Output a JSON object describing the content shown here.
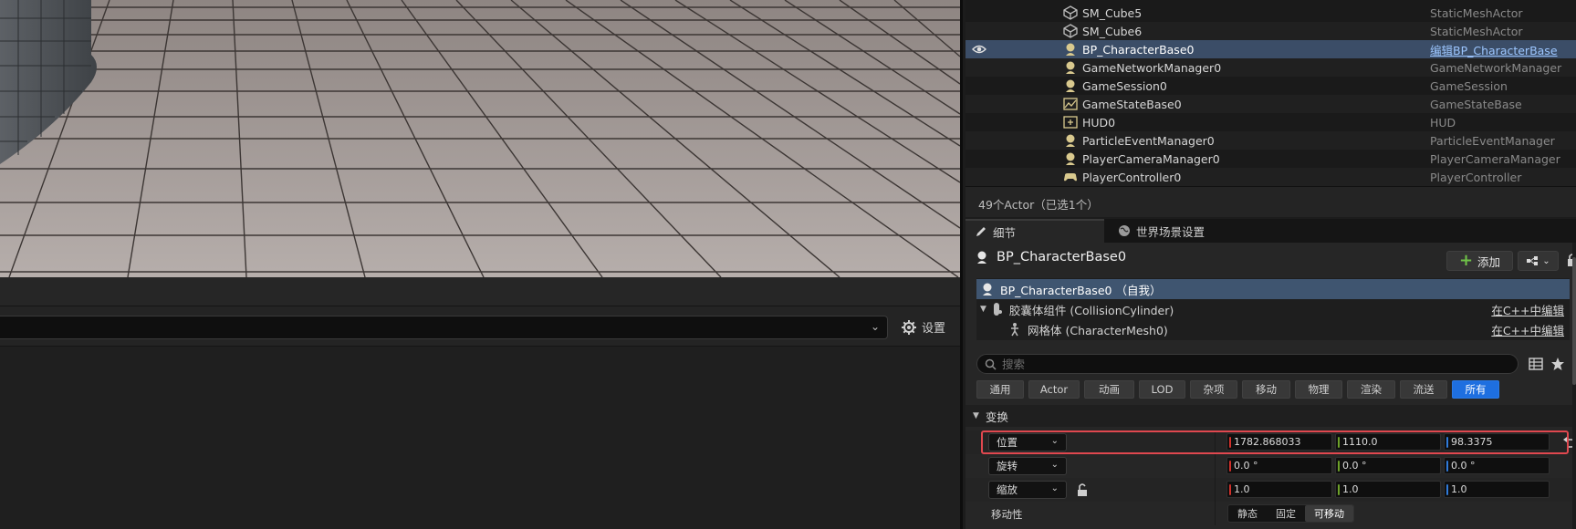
{
  "viewport": {
    "name": "level-viewport"
  },
  "bottom_left": {
    "settings_label": "设置"
  },
  "outliner": {
    "rows": [
      {
        "name": "SM_Cube5",
        "type": "StaticMeshActor",
        "icon": "static-mesh-icon"
      },
      {
        "name": "SM_Cube6",
        "type": "StaticMeshActor",
        "icon": "static-mesh-icon"
      },
      {
        "name": "BP_CharacterBase0",
        "type": "编辑BP_CharacterBase",
        "icon": "pawn-icon",
        "selected": true
      },
      {
        "name": "GameNetworkManager0",
        "type": "GameNetworkManager",
        "icon": "actor-icon"
      },
      {
        "name": "GameSession0",
        "type": "GameSession",
        "icon": "actor-icon"
      },
      {
        "name": "GameStateBase0",
        "type": "GameStateBase",
        "icon": "game-state-icon"
      },
      {
        "name": "HUD0",
        "type": "HUD",
        "icon": "hud-icon"
      },
      {
        "name": "ParticleEventManager0",
        "type": "ParticleEventManager",
        "icon": "actor-icon"
      },
      {
        "name": "PlayerCameraManager0",
        "type": "PlayerCameraManager",
        "icon": "actor-icon"
      },
      {
        "name": "PlayerController0",
        "type": "PlayerController",
        "icon": "gamepad-icon"
      }
    ],
    "status": "49个Actor（已选1个）"
  },
  "tabs": {
    "details": "细节",
    "world_settings": "世界场景设置"
  },
  "details": {
    "actor_name": "BP_CharacterBase0",
    "add_label": "添加",
    "components": [
      {
        "label": "BP_CharacterBase0 （自我）",
        "link": ""
      },
      {
        "label": "胶囊体组件 (CollisionCylinder)",
        "link": "在C++中编辑"
      },
      {
        "label": "网格体 (CharacterMesh0)",
        "link": "在C++中编辑"
      }
    ],
    "search_placeholder": "搜索",
    "filters": [
      "通用",
      "Actor",
      "动画",
      "LOD",
      "杂项",
      "移动",
      "物理",
      "渲染",
      "流送",
      "所有"
    ],
    "active_filter": "所有",
    "section_title": "变换",
    "location": {
      "label": "位置",
      "x": "1782.868033",
      "y": "1110.0",
      "z": "98.3375"
    },
    "rotation": {
      "label": "旋转",
      "x": "0.0 °",
      "y": "0.0 °",
      "z": "0.0 °"
    },
    "scale": {
      "label": "缩放",
      "x": "1.0",
      "y": "1.0",
      "z": "1.0"
    },
    "mobility": {
      "label": "移动性",
      "options": [
        "静态",
        "固定",
        "可移动"
      ],
      "selected": "可移动"
    }
  },
  "colors": {
    "accent": "#1e6fe0",
    "selection": "#3b4d67",
    "highlight": "#e0484f",
    "axis_x": "#d0302a",
    "axis_y": "#6ea229",
    "axis_z": "#2f7bdb"
  }
}
